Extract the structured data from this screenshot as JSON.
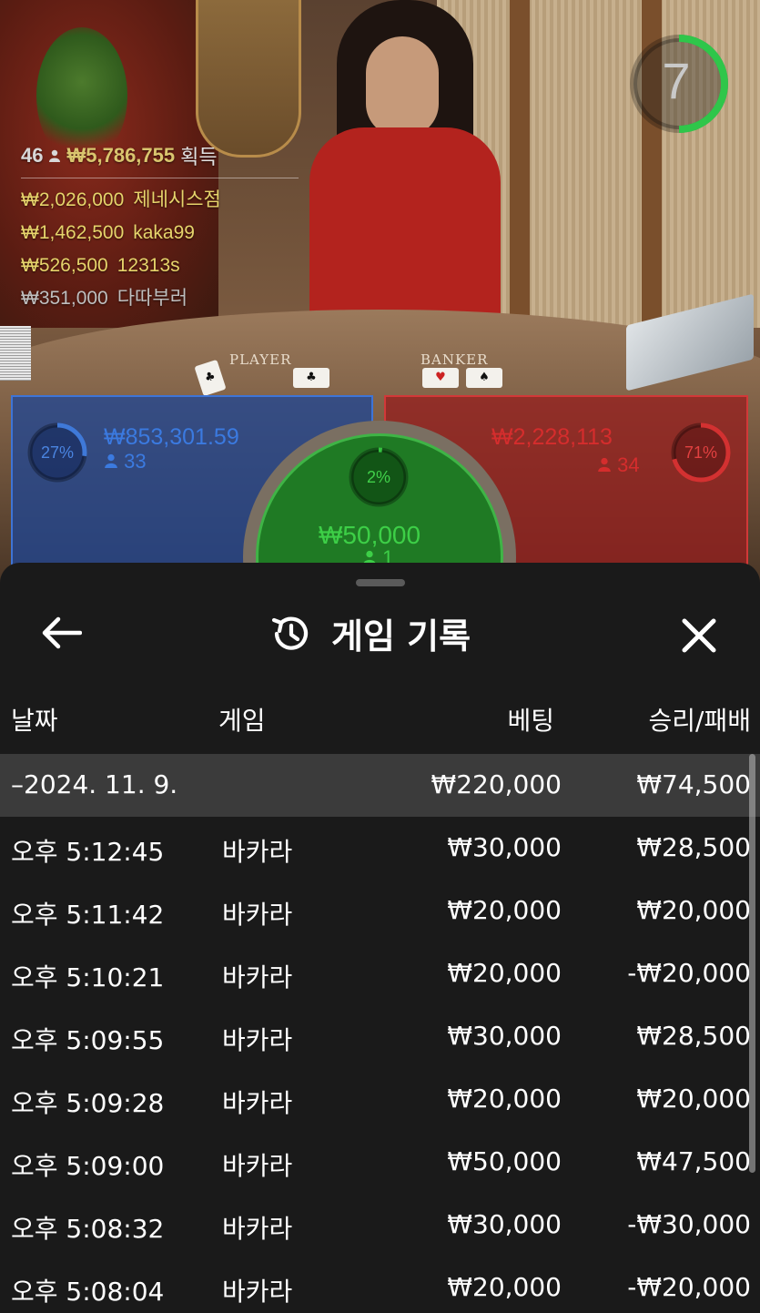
{
  "video": {
    "timer": "7",
    "table_labels": {
      "player": "PLAYER",
      "banker": "BANKER"
    }
  },
  "leaderboard": {
    "count": "46",
    "total": "₩5,786,755",
    "total_label": "획득",
    "rows": [
      {
        "amount": "₩2,026,000",
        "name": "제네시스점"
      },
      {
        "amount": "₩1,462,500",
        "name": "kaka99"
      },
      {
        "amount": "₩526,500",
        "name": "12313s"
      },
      {
        "amount": "₩351,000",
        "name": "다따부러"
      }
    ]
  },
  "bets": {
    "player": {
      "percent": "27%",
      "pot": "₩853,301.59",
      "players": "33",
      "fraction": 0.27
    },
    "tie": {
      "percent": "2%",
      "pot": "₩50,000",
      "players": "1",
      "fraction": 0.02
    },
    "banker": {
      "percent": "71%",
      "pot": "₩2,228,113",
      "players": "34",
      "fraction": 0.71
    }
  },
  "colors": {
    "player": "#3f79d8",
    "banker": "#d33131",
    "tie": "#35c23f"
  },
  "history": {
    "title": "게임 기록",
    "icons": {
      "back": "arrow-left-icon",
      "history": "history-icon",
      "close": "close-icon"
    },
    "columns": {
      "date": "날짜",
      "game": "게임",
      "bet": "베팅",
      "result": "승리/패배"
    },
    "summary": {
      "date": "–2024. 11. 9.",
      "game": "",
      "bet": "₩220,000",
      "result": "₩74,500"
    },
    "rows": [
      {
        "time": "오후 5:12:45",
        "game": "바카라",
        "bet": "₩30,000",
        "result": "₩28,500"
      },
      {
        "time": "오후 5:11:42",
        "game": "바카라",
        "bet": "₩20,000",
        "result": "₩20,000"
      },
      {
        "time": "오후 5:10:21",
        "game": "바카라",
        "bet": "₩20,000",
        "result": "-₩20,000"
      },
      {
        "time": "오후 5:09:55",
        "game": "바카라",
        "bet": "₩30,000",
        "result": "₩28,500"
      },
      {
        "time": "오후 5:09:28",
        "game": "바카라",
        "bet": "₩20,000",
        "result": "₩20,000"
      },
      {
        "time": "오후 5:09:00",
        "game": "바카라",
        "bet": "₩50,000",
        "result": "₩47,500"
      },
      {
        "time": "오후 5:08:32",
        "game": "바카라",
        "bet": "₩30,000",
        "result": "-₩30,000"
      },
      {
        "time": "오후 5:08:04",
        "game": "바카라",
        "bet": "₩20,000",
        "result": "-₩20,000"
      }
    ]
  }
}
